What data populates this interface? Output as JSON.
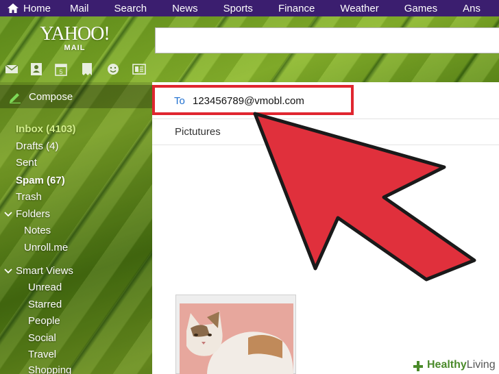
{
  "nav": {
    "home": "Home",
    "items": [
      "Mail",
      "Search",
      "News",
      "Sports",
      "Finance",
      "Weather",
      "Games",
      "Ans"
    ]
  },
  "logo": {
    "big": "YAHOO!",
    "small": "MAIL"
  },
  "compose": {
    "label": "Compose"
  },
  "calendar_day": "5",
  "folders": {
    "inbox": "Inbox (4103)",
    "drafts": "Drafts (4)",
    "sent": "Sent",
    "spam": "Spam (67)",
    "trash": "Trash",
    "folders_header": "Folders",
    "sub": [
      "Notes",
      "Unroll.me"
    ],
    "smart_views_header": "Smart Views",
    "smart": [
      "Unread",
      "Starred",
      "People",
      "Social",
      "Travel",
      "Shopping"
    ]
  },
  "message": {
    "to_label": "To",
    "to_value": "123456789@vmobl.com",
    "subject": "Pictutures"
  },
  "watermark": {
    "bold": "Healthy",
    "rest": "Living"
  },
  "colors": {
    "nav_bg": "#3b1e6f",
    "highlight": "#e0262f",
    "arrow_fill": "#e0303c",
    "to_label": "#1e6fd0"
  }
}
